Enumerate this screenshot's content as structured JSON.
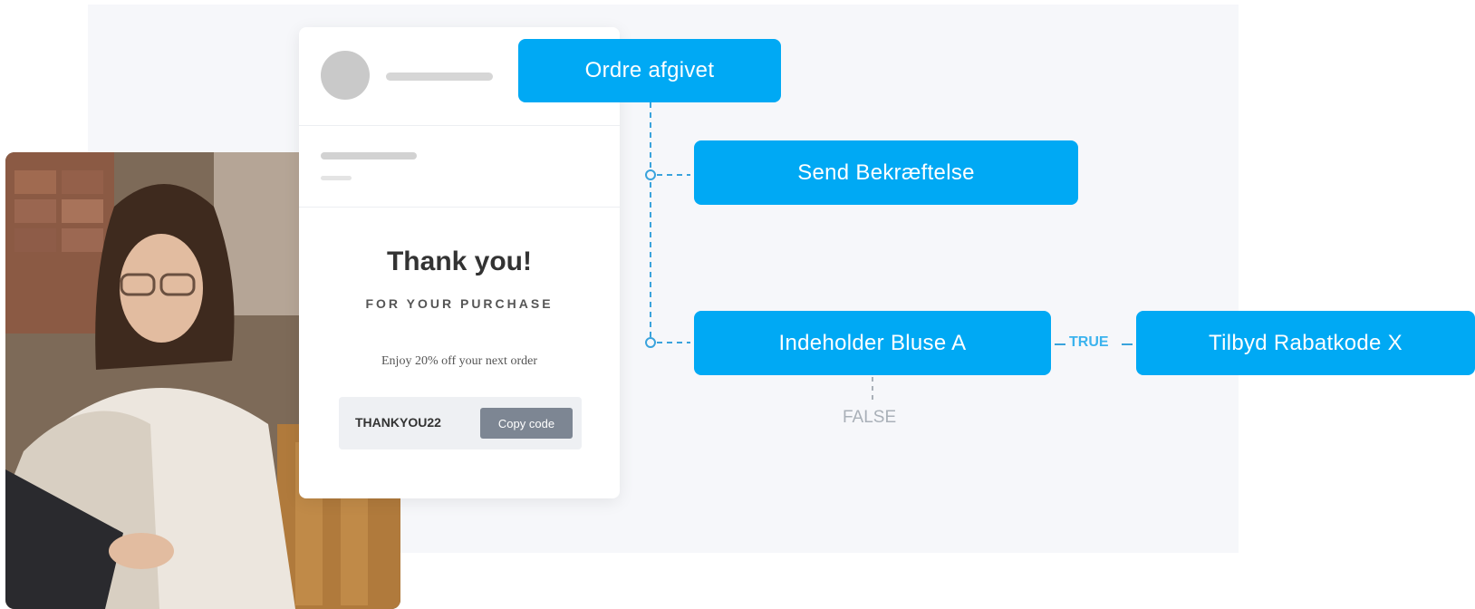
{
  "email": {
    "title": "Thank you!",
    "subtitle": "FOR YOUR PURCHASE",
    "offer": "Enjoy 20% off your next order",
    "coupon_code": "THANKYOU22",
    "copy_button": "Copy code"
  },
  "flow": {
    "trigger": "Ordre afgivet",
    "step_send": "Send Bekræftelse",
    "condition": "Indeholder Bluse A",
    "true_label": "TRUE",
    "true_action": "Tilbyd Rabatkode X",
    "false_label": "FALSE"
  },
  "colors": {
    "node": "#00a9f4",
    "connector": "#3aa3dc",
    "false_text": "#a9b0b8"
  }
}
